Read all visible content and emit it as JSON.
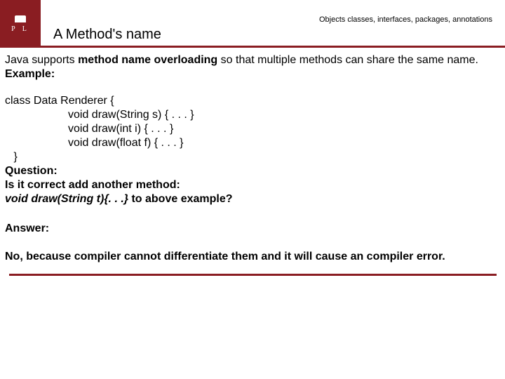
{
  "header": {
    "logo_letters": "P   L",
    "breadcrumb": "Objects classes, interfaces, packages, annotations",
    "title": "A Method's name"
  },
  "intro": {
    "pre": "Java supports ",
    "bold": "method name overloading",
    "post": " so that multiple methods can share the same name. ",
    "example_label": "Example:"
  },
  "code": {
    "l1": "class Data Renderer {",
    "l2": "void draw(String s) { . . . }",
    "l3": "void draw(int i) { . . . }",
    "l4": "void draw(float f) { . . . }",
    "l5": " }"
  },
  "question": {
    "label": "Question:",
    "line1": "Is it correct add another method:",
    "method": "void draw(String t){. . .}",
    "tail": " to above example?"
  },
  "answer": {
    "label": "Answer:",
    "body": "No, because compiler cannot differentiate them and it will cause an compiler error."
  }
}
